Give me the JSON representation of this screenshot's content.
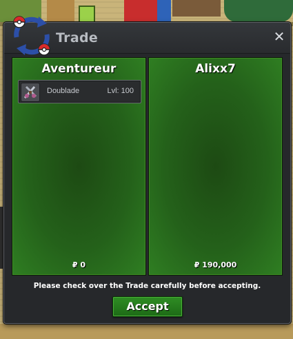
{
  "window": {
    "title": "Trade",
    "close_label": "✕"
  },
  "left_panel": {
    "player_name": "Aventureur",
    "money": "₽ 0",
    "items": [
      {
        "name": "Doublade",
        "level": "Lvl: 100",
        "icon": "doublade-sprite-icon"
      }
    ]
  },
  "right_panel": {
    "player_name": "Alixx7",
    "money": "₽ 190,000",
    "items": []
  },
  "notice": "Please check over the Trade carefully before accepting.",
  "accept_label": "Accept",
  "colors": {
    "panel_green": "#24611a",
    "accept_green": "#2f8d24",
    "window_bg": "#26282b",
    "title_text": "#b7bbc1"
  }
}
